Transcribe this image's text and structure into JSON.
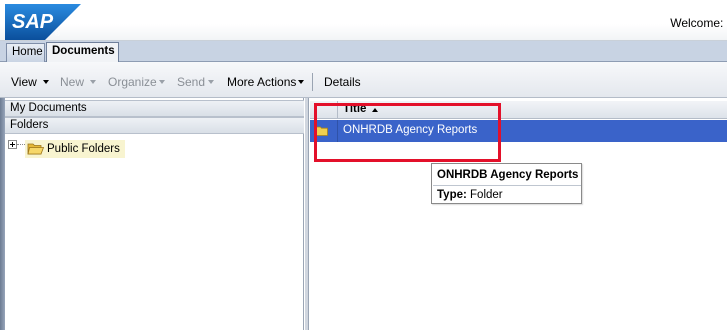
{
  "header": {
    "logo_text": "SAP",
    "welcome_text": "Welcome: '"
  },
  "tabs": [
    {
      "label": "Home"
    },
    {
      "label": "Documents"
    }
  ],
  "toolbar": {
    "view_label": "View",
    "new_label": "New",
    "organize_label": "Organize",
    "send_label": "Send",
    "more_actions_label": "More Actions",
    "details_label": "Details"
  },
  "left_pane": {
    "my_documents_label": "My Documents",
    "folders_label": "Folders",
    "tree": [
      {
        "label": "Public Folders",
        "icon": "open-folder-icon",
        "expanded": false
      }
    ]
  },
  "grid": {
    "columns": [
      {
        "label": "Title",
        "sort": "ascending"
      }
    ],
    "rows": [
      {
        "title": "ONHRDB Agency Reports",
        "icon": "folder-icon",
        "selected": true
      }
    ]
  },
  "tooltip": {
    "title": "ONHRDB Agency Reports",
    "type_label": "Type:",
    "type_value": "Folder"
  },
  "colors": {
    "selection": "#3a63c9",
    "highlight_box": "#e3102a",
    "sap_blue": "#1b6fc0"
  }
}
